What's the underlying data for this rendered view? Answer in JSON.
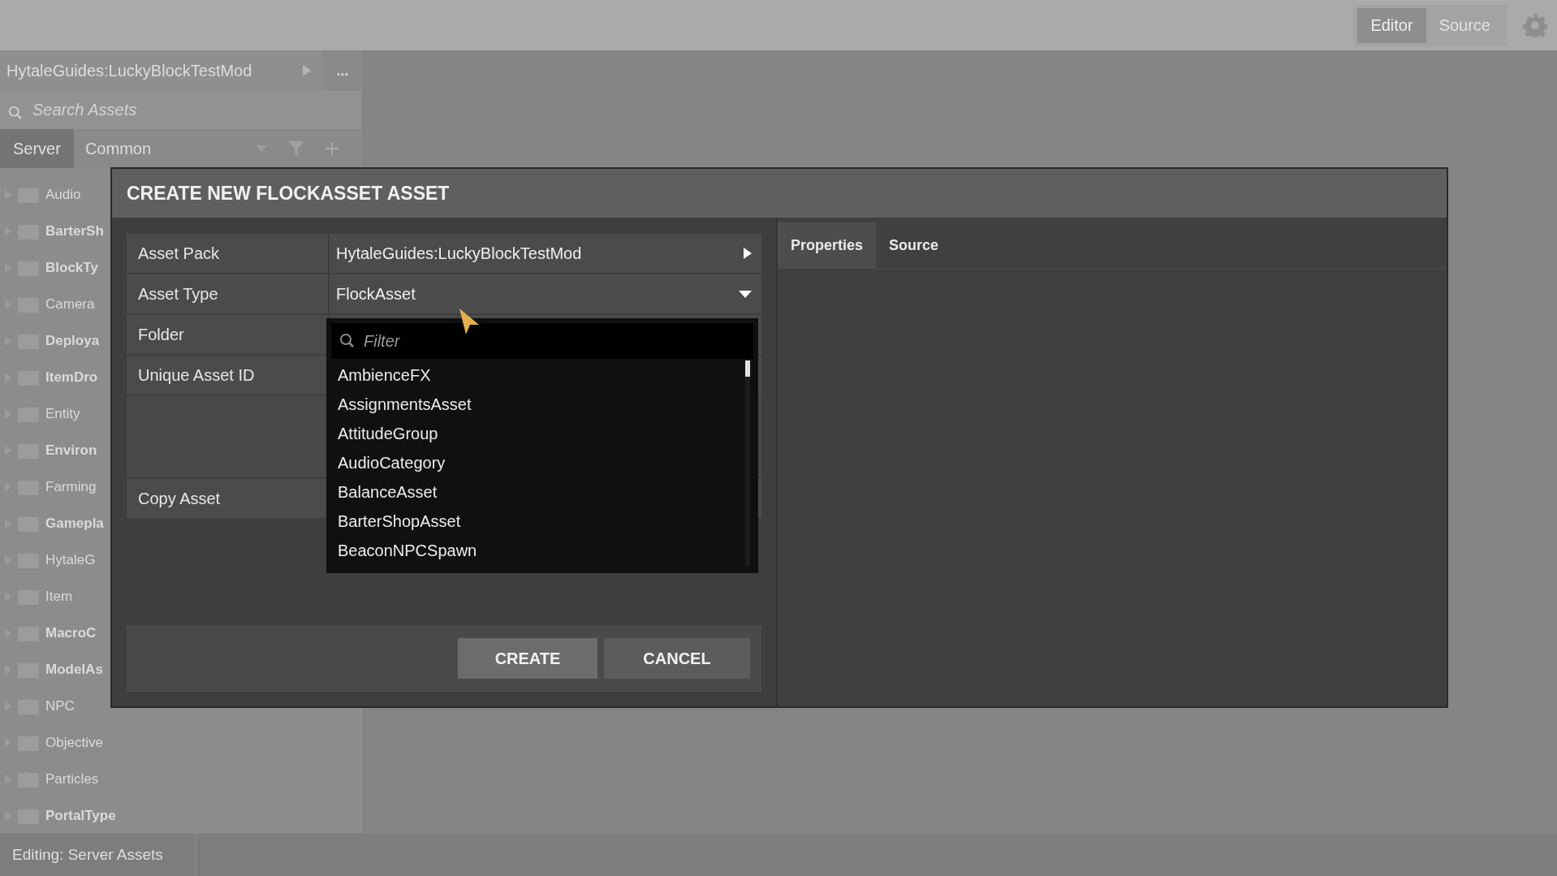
{
  "top_bar": {
    "mode_tabs": [
      {
        "label": "Editor",
        "selected": true
      },
      {
        "label": "Source",
        "selected": false
      }
    ]
  },
  "sidebar": {
    "pack": "HytaleGuides:LuckyBlockTestMod",
    "more": "...",
    "search": {
      "placeholder": "Search Assets"
    },
    "tabs": [
      {
        "label": "Server",
        "selected": true
      }
    ],
    "category": "Common",
    "items": [
      {
        "label": "Audio",
        "emphasized": false
      },
      {
        "label": "BarterSh",
        "emphasized": true
      },
      {
        "label": "BlockTy",
        "emphasized": true
      },
      {
        "label": "Camera",
        "emphasized": false
      },
      {
        "label": "Deploya",
        "emphasized": true
      },
      {
        "label": "ItemDro",
        "emphasized": true
      },
      {
        "label": "Entity",
        "emphasized": false
      },
      {
        "label": "Environ",
        "emphasized": true
      },
      {
        "label": "Farming",
        "emphasized": false
      },
      {
        "label": "Gamepla",
        "emphasized": true
      },
      {
        "label": "HytaleG",
        "emphasized": false
      },
      {
        "label": "Item",
        "emphasized": false
      },
      {
        "label": "MacroC",
        "emphasized": true
      },
      {
        "label": "ModelAs",
        "emphasized": true
      },
      {
        "label": "NPC",
        "emphasized": false
      },
      {
        "label": "Objective",
        "emphasized": false
      },
      {
        "label": "Particles",
        "emphasized": false
      },
      {
        "label": "PortalType",
        "emphasized": true
      }
    ]
  },
  "status_bar": "Editing: Server Assets",
  "dialog": {
    "title": "CREATE NEW FLOCKASSET ASSET",
    "fields": [
      {
        "label": "Asset Pack",
        "value": "HytaleGuides:LuckyBlockTestMod",
        "kind": "submenu"
      },
      {
        "label": "Asset Type",
        "value": "FlockAsset",
        "kind": "dropdown"
      },
      {
        "label": "Folder",
        "kind": "blank"
      },
      {
        "label": "Unique Asset ID",
        "kind": "blank"
      },
      {
        "kind": "spacer"
      },
      {
        "label": "Copy Asset",
        "kind": "blank"
      }
    ],
    "dropdown": {
      "filter": {
        "placeholder": "Filter"
      },
      "options": [
        "AmbienceFX",
        "AssignmentsAsset",
        "AttitudeGroup",
        "AudioCategory",
        "BalanceAsset",
        "BarterShopAsset",
        "BeaconNPCSpawn"
      ]
    },
    "buttons": [
      "CREATE",
      "CANCEL"
    ],
    "panel_tabs": [
      {
        "label": "Properties",
        "selected": true
      },
      {
        "label": "Source",
        "selected": false
      }
    ]
  }
}
